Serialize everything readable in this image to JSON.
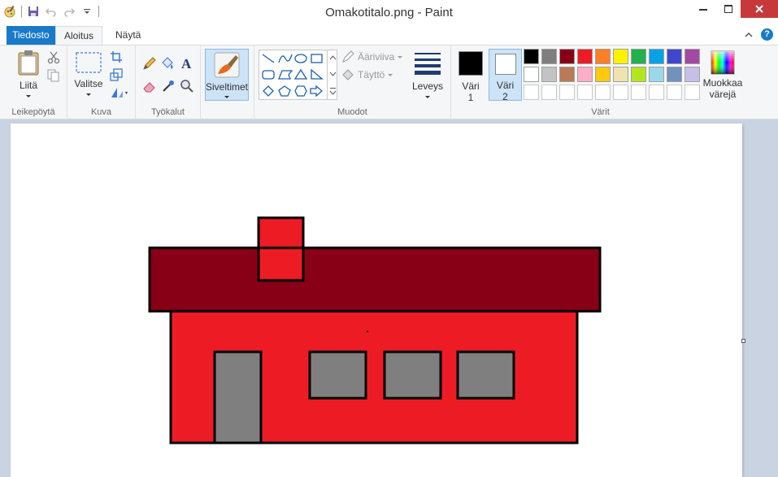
{
  "window": {
    "title": "Omakotitalo.png - Paint"
  },
  "tabs": {
    "file": "Tiedosto",
    "home": "Aloitus",
    "view": "Näytä"
  },
  "groups": {
    "clipboard": {
      "label": "Leikepöytä",
      "paste": "Liitä"
    },
    "image": {
      "label": "Kuva",
      "select": "Valitse"
    },
    "tools": {
      "label": "Työkalut"
    },
    "brushes": {
      "label": "Siveltimet"
    },
    "shapes": {
      "label": "Muodot",
      "outline": "Ääriviiva",
      "fill": "Täyttö"
    },
    "size": {
      "label": "Leveys"
    },
    "colors": {
      "label": "Värit",
      "color1_a": "Väri",
      "color1_b": "1",
      "color2_a": "Väri",
      "color2_b": "2",
      "edit_a": "Muokkaa",
      "edit_b": "värejä",
      "color1_value": "#000000",
      "color2_value": "#ffffff",
      "palette_row1": [
        "#000000",
        "#7f7f7f",
        "#880015",
        "#ed1c24",
        "#ff7f27",
        "#fff200",
        "#22b14c",
        "#00a2e8",
        "#3f48cc",
        "#a349a4"
      ],
      "palette_row2": [
        "#ffffff",
        "#c3c3c3",
        "#b97a57",
        "#ffaec9",
        "#ffc90e",
        "#efe4b0",
        "#b5e61d",
        "#99d9ea",
        "#7092be",
        "#c8bfe7"
      ]
    }
  },
  "drawing": {
    "roof_color": "#880015",
    "wall_color": "#ed1c24",
    "window_color": "#7f7f7f",
    "outline_color": "#000000"
  }
}
